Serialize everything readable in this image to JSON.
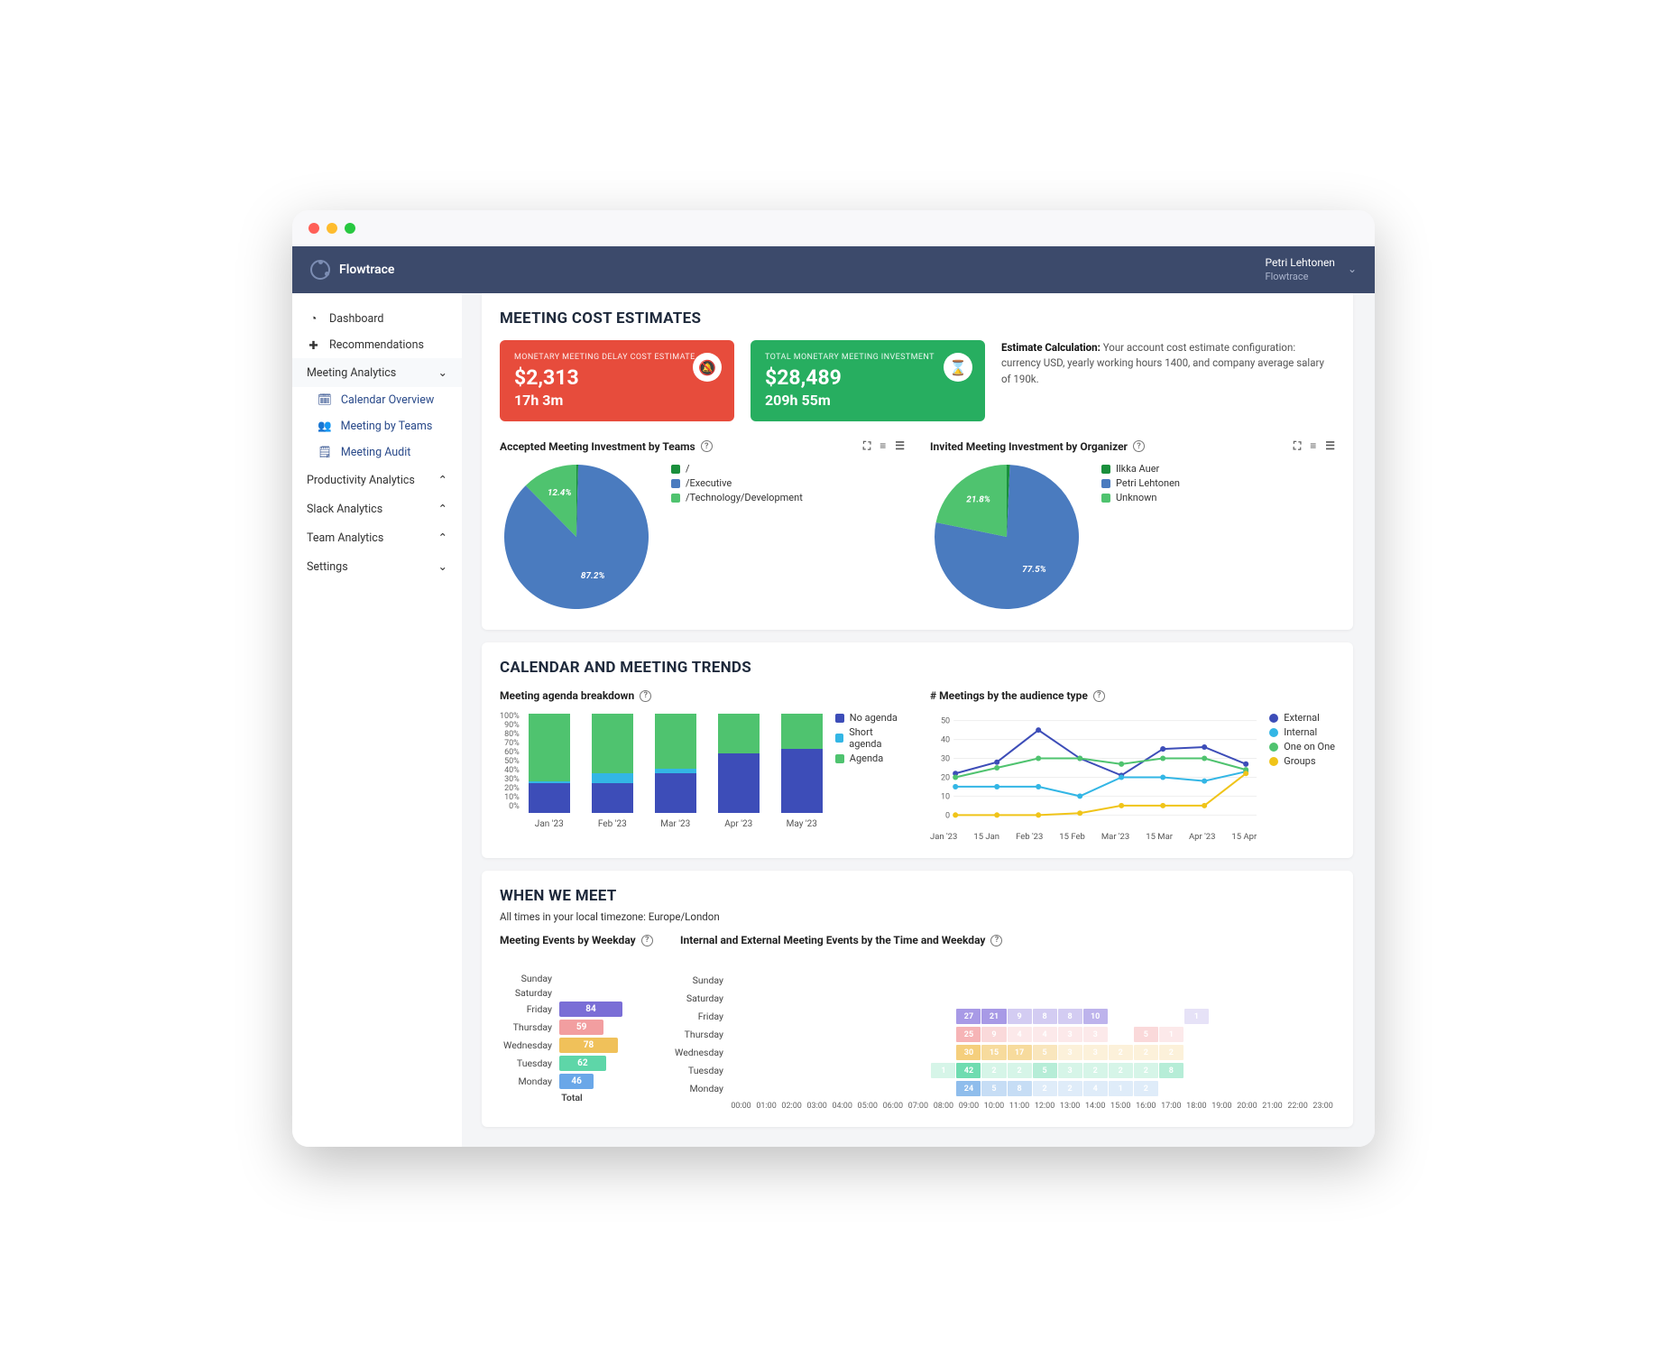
{
  "brand": "Flowtrace",
  "user": {
    "name": "Petri Lehtonen",
    "company": "Flowtrace"
  },
  "sidebar": {
    "dashboard": "Dashboard",
    "recommendations": "Recommendations",
    "meeting_analytics": "Meeting Analytics",
    "sub": {
      "cal": "Calendar Overview",
      "teams": "Meeting by Teams",
      "audit": "Meeting Audit"
    },
    "productivity": "Productivity Analytics",
    "slack": "Slack Analytics",
    "team": "Team Analytics",
    "settings": "Settings"
  },
  "sec1": {
    "title": "MEETING COST ESTIMATES",
    "card1": {
      "lbl": "MONETARY MEETING DELAY COST ESTIMATE",
      "big": "$2,313",
      "sub": "17h 3m"
    },
    "card2": {
      "lbl": "TOTAL MONETARY MEETING INVESTMENT",
      "big": "$28,489",
      "sub": "209h 55m"
    },
    "estlabel": "Estimate Calculation:",
    "esttext": "Your account cost estimate configuration: currency USD, yearly working hours 1400, and company average salary of 190k.",
    "chartA_title": "Accepted Meeting Investment by Teams",
    "chartB_title": "Invited Meeting Investment by Organizer"
  },
  "sec2": {
    "title": "CALENDAR AND MEETING TRENDS",
    "chartC_title": "Meeting agenda breakdown",
    "chartD_title": "# Meetings by the audience type"
  },
  "sec3": {
    "title": "WHEN WE MEET",
    "subtitle": "All times in your local timezone: Europe/London",
    "chartE_title": "Meeting Events by Weekday",
    "chartF_title": "Internal and External Meeting Events by the Time and Weekday",
    "total_label": "Total"
  },
  "chart_data": [
    {
      "id": "A",
      "type": "pie",
      "title": "Accepted Meeting Investment by Teams",
      "series": [
        {
          "name": "/",
          "value": 0.4,
          "color": "#1a8f3c"
        },
        {
          "name": "/Executive",
          "value": 87.2,
          "color": "#4a7bbf"
        },
        {
          "name": "/Technology/Development",
          "value": 12.4,
          "color": "#4fc36f"
        }
      ]
    },
    {
      "id": "B",
      "type": "pie",
      "title": "Invited Meeting Investment by Organizer",
      "series": [
        {
          "name": "Ilkka Auer",
          "value": 0.7,
          "color": "#1a8f3c"
        },
        {
          "name": "Petri Lehtonen",
          "value": 77.5,
          "color": "#4a7bbf"
        },
        {
          "name": "Unknown",
          "value": 21.8,
          "color": "#4fc36f"
        }
      ]
    },
    {
      "id": "C",
      "type": "bar",
      "stacked": true,
      "title": "Meeting agenda breakdown",
      "ylabel": "%",
      "ylim": [
        0,
        100
      ],
      "yticks": [
        0,
        10,
        20,
        30,
        40,
        50,
        60,
        70,
        80,
        90,
        100
      ],
      "categories": [
        "Jan '23",
        "Feb '23",
        "Mar '23",
        "Apr '23",
        "May '23"
      ],
      "series": [
        {
          "name": "No agenda",
          "color": "#3d4db8",
          "values": [
            30,
            30,
            40,
            60,
            65
          ]
        },
        {
          "name": "Short agenda",
          "color": "#33b6e5",
          "values": [
            2,
            10,
            5,
            0,
            0
          ]
        },
        {
          "name": "Agenda",
          "color": "#4fc36f",
          "values": [
            68,
            60,
            55,
            40,
            35
          ]
        }
      ]
    },
    {
      "id": "D",
      "type": "line",
      "title": "# Meetings by the audience type",
      "ylim": [
        0,
        50
      ],
      "yticks": [
        0,
        10,
        20,
        30,
        40,
        50
      ],
      "x": [
        "Jan '23",
        "15 Jan",
        "Feb '23",
        "15 Feb",
        "Mar '23",
        "15 Mar",
        "Apr '23",
        "15 Apr"
      ],
      "series": [
        {
          "name": "External",
          "color": "#3d4db8",
          "values": [
            22,
            28,
            45,
            30,
            21,
            35,
            36,
            27
          ]
        },
        {
          "name": "Internal",
          "color": "#33b6e5",
          "values": [
            15,
            15,
            15,
            10,
            20,
            20,
            18,
            23
          ]
        },
        {
          "name": "One on One",
          "color": "#4fc36f",
          "values": [
            20,
            25,
            30,
            30,
            27,
            30,
            30,
            24
          ]
        },
        {
          "name": "Groups",
          "color": "#f0c419",
          "values": [
            0,
            0,
            0,
            1,
            5,
            5,
            5,
            22
          ]
        }
      ]
    },
    {
      "id": "E",
      "type": "bar",
      "orientation": "h",
      "title": "Meeting Events by Weekday",
      "categories": [
        "Sunday",
        "Saturday",
        "Friday",
        "Thursday",
        "Wednesday",
        "Tuesday",
        "Monday"
      ],
      "values": [
        null,
        null,
        84,
        59,
        78,
        62,
        46
      ],
      "colors": [
        null,
        null,
        "#7a6ed6",
        "#f29ea0",
        "#f0c15a",
        "#5ed6a8",
        "#6aa7e8"
      ]
    },
    {
      "id": "F",
      "type": "heatmap",
      "title": "Internal and External Meeting Events by the Time and Weekday",
      "rows": [
        "Sunday",
        "Saturday",
        "Friday",
        "Thursday",
        "Wednesday",
        "Tuesday",
        "Monday"
      ],
      "cols": [
        "00:00",
        "01:00",
        "02:00",
        "03:00",
        "04:00",
        "05:00",
        "06:00",
        "07:00",
        "08:00",
        "09:00",
        "10:00",
        "11:00",
        "12:00",
        "13:00",
        "14:00",
        "15:00",
        "16:00",
        "17:00",
        "18:00",
        "19:00",
        "20:00",
        "21:00",
        "22:00",
        "23:00"
      ],
      "values": [
        [
          null,
          null,
          null,
          null,
          null,
          null,
          null,
          null,
          null,
          null,
          null,
          null,
          null,
          null,
          null,
          null,
          null,
          null,
          null,
          null,
          null,
          null,
          null,
          null
        ],
        [
          null,
          null,
          null,
          null,
          null,
          null,
          null,
          null,
          null,
          null,
          null,
          null,
          null,
          null,
          null,
          null,
          null,
          null,
          null,
          null,
          null,
          null,
          null,
          null
        ],
        [
          null,
          null,
          null,
          null,
          null,
          null,
          null,
          null,
          null,
          27,
          21,
          9,
          8,
          8,
          10,
          null,
          null,
          null,
          1,
          null,
          null,
          null,
          null,
          null
        ],
        [
          null,
          null,
          null,
          null,
          null,
          null,
          null,
          null,
          null,
          25,
          9,
          4,
          4,
          3,
          3,
          null,
          5,
          1,
          null,
          null,
          null,
          null,
          null,
          null
        ],
        [
          null,
          null,
          null,
          null,
          null,
          null,
          null,
          null,
          null,
          30,
          15,
          17,
          5,
          3,
          3,
          2,
          2,
          2,
          null,
          null,
          null,
          null,
          null,
          null
        ],
        [
          null,
          null,
          null,
          null,
          null,
          null,
          null,
          null,
          1,
          42,
          2,
          2,
          5,
          3,
          2,
          2,
          2,
          8,
          null,
          null,
          null,
          null,
          null,
          null
        ],
        [
          null,
          null,
          null,
          null,
          null,
          null,
          null,
          null,
          null,
          24,
          5,
          8,
          2,
          2,
          4,
          1,
          2,
          null,
          null,
          null,
          null,
          null,
          null,
          null
        ]
      ],
      "row_colors": [
        null,
        null,
        "#a89ae6",
        "#f6b4b6",
        "#f5cf7d",
        "#6fdcb0",
        "#8fbdec"
      ]
    }
  ]
}
